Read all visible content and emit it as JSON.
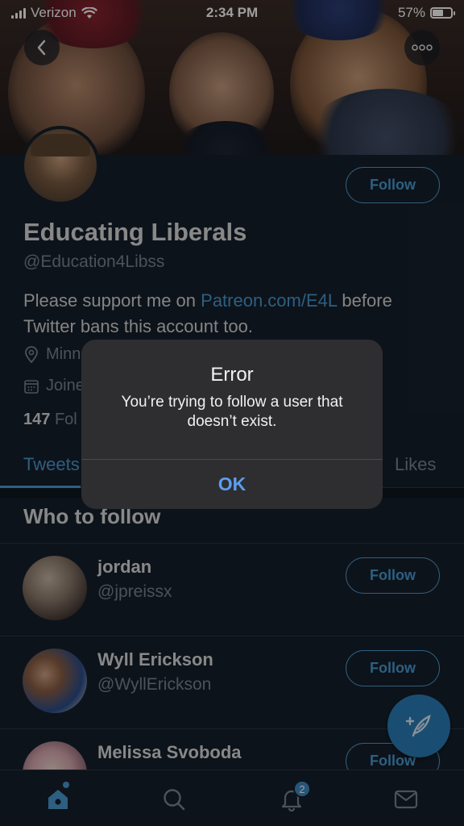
{
  "status_bar": {
    "carrier": "Verizon",
    "time": "2:34 PM",
    "battery": "57%",
    "battery_level": 0.57
  },
  "header": {
    "back_icon": "chevron-left-icon",
    "more_icon": "ellipsis-icon"
  },
  "profile": {
    "follow_label": "Follow",
    "display_name": "Educating Liberals",
    "handle": "@Education4Libss",
    "bio_before": "Please support me on ",
    "bio_link": "Patreon.com/E4L",
    "bio_after": " before Twitter bans this account too.",
    "location": "Minn",
    "joined": "Joine",
    "following_count": "147",
    "following_label": "Fol"
  },
  "tabs": {
    "tweets": "Tweets",
    "likes": "Likes"
  },
  "who_to_follow": {
    "title": "Who to follow",
    "users": [
      {
        "name": "jordan",
        "handle": "@jpreissx",
        "follow_label": "Follow"
      },
      {
        "name": "Wyll Erickson",
        "handle": "@WyllErickson",
        "follow_label": "Follow"
      },
      {
        "name": "Melissa Svoboda",
        "handle": "",
        "follow_label": "Follow"
      }
    ]
  },
  "bottom_nav": {
    "notifications_badge": "2"
  },
  "alert": {
    "title": "Error",
    "message": "You’re trying to follow a user that doesn’t exist.",
    "ok_label": "OK"
  },
  "colors": {
    "accent": "#4a9ad1",
    "background": "#15202b",
    "alert_button": "#5b9ef0"
  }
}
